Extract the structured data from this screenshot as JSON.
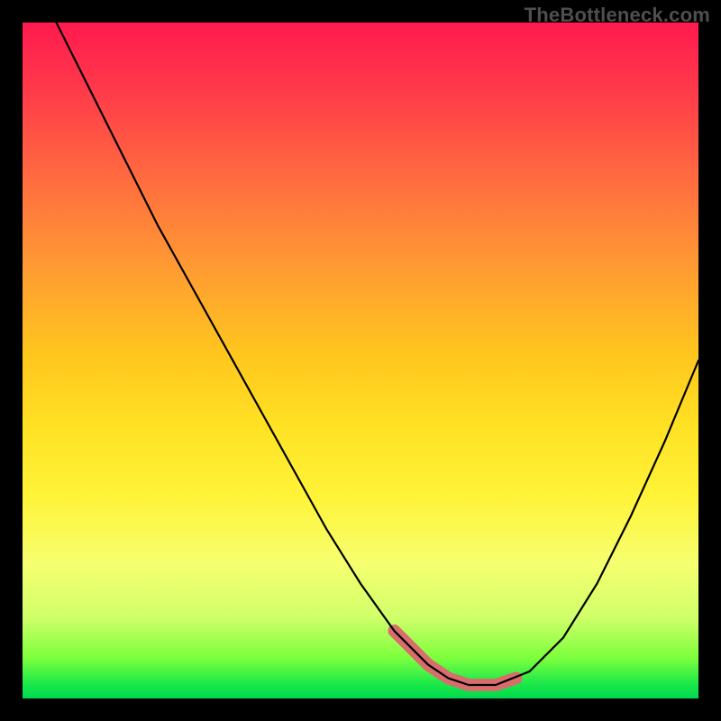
{
  "watermark": "TheBottleneck.com",
  "chart_data": {
    "type": "line",
    "title": "",
    "xlabel": "",
    "ylabel": "",
    "xlim": [
      0,
      100
    ],
    "ylim": [
      0,
      100
    ],
    "grid": false,
    "background_gradient": [
      "#ff1a4f",
      "#ff6b3f",
      "#ffc61e",
      "#fff338",
      "#7dff3d",
      "#00d84e"
    ],
    "series": [
      {
        "name": "curve",
        "color": "#000000",
        "x": [
          5,
          10,
          15,
          20,
          25,
          30,
          35,
          40,
          45,
          50,
          55,
          60,
          63,
          66,
          70,
          75,
          80,
          85,
          90,
          95,
          100
        ],
        "y": [
          100,
          90,
          80,
          70,
          61,
          52,
          43,
          34,
          25,
          17,
          10,
          5,
          3,
          2,
          2,
          4,
          9,
          17,
          27,
          38,
          50
        ]
      }
    ],
    "highlight": {
      "name": "min-region",
      "color": "#d96d6d",
      "x": [
        55,
        60,
        63,
        66,
        70,
        73
      ],
      "y": [
        10,
        5,
        3,
        2,
        2,
        3
      ]
    }
  }
}
